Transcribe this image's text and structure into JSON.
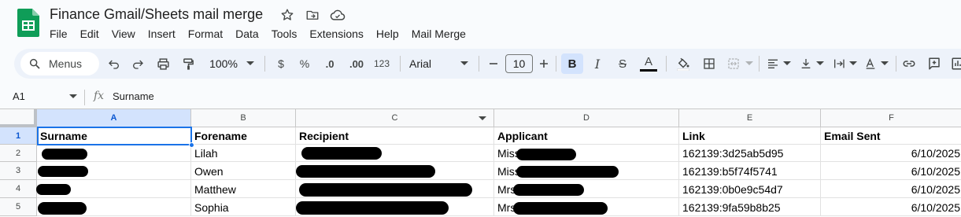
{
  "document": {
    "title": "Finance Gmail/Sheets mail merge"
  },
  "menu": [
    "File",
    "Edit",
    "View",
    "Insert",
    "Format",
    "Data",
    "Tools",
    "Extensions",
    "Help",
    "Mail Merge"
  ],
  "toolbar": {
    "search_label": "Menus",
    "zoom": "100%",
    "currency": "$",
    "percent": "%",
    "decrease_decimal": ".0",
    "increase_decimal": ".00",
    "more_formats": "123",
    "font": "Arial",
    "font_size": "10",
    "bold": "B",
    "italic": "I",
    "strike": "S",
    "text_color": "A"
  },
  "formula_bar": {
    "cell_ref": "A1",
    "fx": "fx",
    "value": "Surname"
  },
  "columns": [
    "A",
    "B",
    "C",
    "D",
    "E",
    "F"
  ],
  "rows": [
    {
      "num": "1",
      "cells": [
        "Surname",
        "Forename",
        "Recipient",
        "Applicant",
        "Link",
        "Email Sent"
      ]
    },
    {
      "num": "2",
      "cells": [
        "",
        "Lilah",
        "",
        "Miss",
        "162139:3d25ab5d95",
        "6/10/2025"
      ]
    },
    {
      "num": "3",
      "cells": [
        "",
        "Owen",
        "",
        "Miss",
        "162139:b5f74f5741",
        "6/10/2025"
      ]
    },
    {
      "num": "4",
      "cells": [
        "",
        "Matthew",
        "",
        "Mrs",
        "162139:0b0e9c54d7",
        "6/10/2025"
      ]
    },
    {
      "num": "5",
      "cells": [
        "",
        "Sophia",
        "",
        "Mrs",
        "162139:9fa59b8b25",
        "6/10/2025"
      ]
    }
  ],
  "colors": {
    "accent": "#1a73e8",
    "toolbar_bg": "#edf2fa",
    "selected_header": "#d3e3fd",
    "logo_green": "#0f9d58"
  }
}
